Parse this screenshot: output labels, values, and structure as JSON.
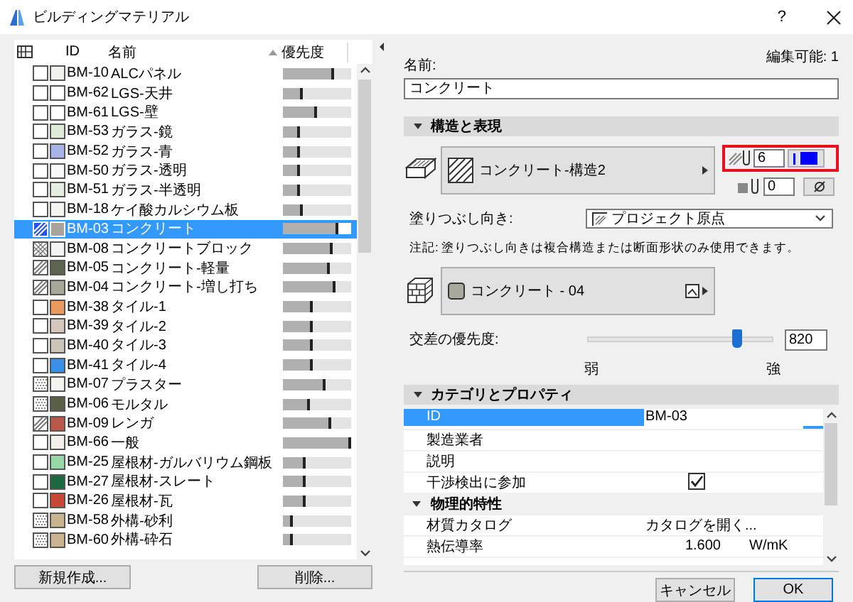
{
  "window": {
    "title": "ビルディングマテリアル",
    "help": "?"
  },
  "list": {
    "columns": [
      "ID",
      "名前",
      "優先度"
    ],
    "rows": [
      {
        "id": "BM-10",
        "name": "ALCパネル",
        "kind": "empty",
        "color": "#f0f0ec",
        "level": 0.75,
        "selected": false
      },
      {
        "id": "BM-62",
        "name": "LGS-天井",
        "kind": "empty",
        "color": "#ffffff",
        "level": 0.3,
        "selected": false
      },
      {
        "id": "BM-61",
        "name": "LGS-壁",
        "kind": "empty",
        "color": "#ffffff",
        "level": 0.5,
        "selected": false
      },
      {
        "id": "BM-53",
        "name": "ガラス-鏡",
        "kind": "empty",
        "color": "#e0ead8",
        "level": 0.25,
        "selected": false
      },
      {
        "id": "BM-52",
        "name": "ガラス-青",
        "kind": "empty",
        "color": "#a8b4e8",
        "level": 0.25,
        "selected": false
      },
      {
        "id": "BM-50",
        "name": "ガラス-透明",
        "kind": "empty",
        "color": "#f8f8f8",
        "level": 0.25,
        "selected": false
      },
      {
        "id": "BM-51",
        "name": "ガラス-半透明",
        "kind": "empty",
        "color": "#e4eee0",
        "level": 0.25,
        "selected": false
      },
      {
        "id": "BM-18",
        "name": "ケイ酸カルシウム板",
        "kind": "empty",
        "color": "#f4f4f0",
        "level": 0.3,
        "selected": false
      },
      {
        "id": "BM-03",
        "name": "コンクリート",
        "kind": "hatch",
        "color": "#a8a49c",
        "level": 0.82,
        "selected": true
      },
      {
        "id": "BM-08",
        "name": "コンクリートブロック",
        "kind": "crosshatch",
        "color": "#f4f4f4",
        "level": 0.72,
        "selected": false
      },
      {
        "id": "BM-05",
        "name": "コンクリート-軽量",
        "kind": "hatch",
        "color": "#5c6450",
        "level": 0.68,
        "selected": false
      },
      {
        "id": "BM-04",
        "name": "コンクリート-増し打ち",
        "kind": "hatch",
        "color": "#a8a898",
        "level": 0.78,
        "selected": false
      },
      {
        "id": "BM-38",
        "name": "タイル-1",
        "kind": "empty",
        "color": "#e89a60",
        "level": 0.43,
        "selected": false
      },
      {
        "id": "BM-39",
        "name": "タイル-2",
        "kind": "empty",
        "color": "#d4c8bc",
        "level": 0.43,
        "selected": false
      },
      {
        "id": "BM-40",
        "name": "タイル-3",
        "kind": "empty",
        "color": "#ccc4b8",
        "level": 0.43,
        "selected": false
      },
      {
        "id": "BM-41",
        "name": "タイル-4",
        "kind": "empty",
        "color": "#3890e8",
        "level": 0.43,
        "selected": false
      },
      {
        "id": "BM-07",
        "name": "プラスター",
        "kind": "dots",
        "color": "#f4f4f0",
        "level": 0.62,
        "selected": false
      },
      {
        "id": "BM-06",
        "name": "モルタル",
        "kind": "dots",
        "color": "#5a6048",
        "level": 0.4,
        "selected": false
      },
      {
        "id": "BM-09",
        "name": "レンガ",
        "kind": "hatch",
        "color": "#b85848",
        "level": 0.7,
        "selected": false
      },
      {
        "id": "BM-66",
        "name": "一般",
        "kind": "empty",
        "color": "#f4f0ec",
        "level": 1.0,
        "selected": false
      },
      {
        "id": "BM-25",
        "name": "屋根材-ガルバリウム鋼板",
        "kind": "empty",
        "color": "#98d8a8",
        "level": 0.33,
        "selected": false
      },
      {
        "id": "BM-27",
        "name": "屋根材-スレート",
        "kind": "empty",
        "color": "#1c6840",
        "level": 0.33,
        "selected": false
      },
      {
        "id": "BM-26",
        "name": "屋根材-瓦",
        "kind": "empty",
        "color": "#c84838",
        "level": 0.33,
        "selected": false
      },
      {
        "id": "BM-58",
        "name": "外構-砂利",
        "kind": "dots",
        "color": "#c8b490",
        "level": 0.15,
        "selected": false
      },
      {
        "id": "BM-60",
        "name": "外構-砕石",
        "kind": "dots",
        "color": "#c8b490",
        "level": 0.14,
        "selected": false
      }
    ]
  },
  "list_buttons": [
    "新規作成...",
    "削除..."
  ],
  "editor": {
    "editable": "編集可能: 1",
    "name_label": "名前:",
    "name_value": "コンクリート",
    "structure_section": {
      "title": "構造と表現",
      "expanded": true
    },
    "cut_fill": "コンクリート-構造2",
    "pen_value": "6",
    "background_pen_value": "0",
    "orientation_label": "塗りつぶし向き:",
    "orientation_value": "プロジェクト原点",
    "note": "注記: 塗りつぶし向きは複合構造または断面形状のみ使用できます。",
    "surface": "コンクリート - 04",
    "priority_label": "交差の優先度:",
    "priority": {
      "level": 0.8,
      "value": "820",
      "min_label": "弱",
      "max_label": "強"
    },
    "properties_section": {
      "title": "カテゴリとプロパティ",
      "expanded": true
    },
    "properties": [
      {
        "kind": "row",
        "label": "ID",
        "value": "BM-03",
        "selected": true
      },
      {
        "kind": "row",
        "label": "製造業者",
        "selected": false
      },
      {
        "kind": "row",
        "label": "説明",
        "selected": false
      },
      {
        "kind": "check",
        "label": "干渉検出に参加",
        "checked": true,
        "selected": false
      },
      {
        "kind": "group",
        "label": "物理的特性",
        "expanded": true
      },
      {
        "kind": "row",
        "label": "材質カタログ",
        "value": "カタログを開く...",
        "selected": false
      },
      {
        "kind": "row",
        "label": "熱伝導率",
        "value": "1.600",
        "unit": "W/mK",
        "selected": false
      }
    ]
  },
  "dialog_buttons": [
    "キャンセル",
    "OK"
  ]
}
